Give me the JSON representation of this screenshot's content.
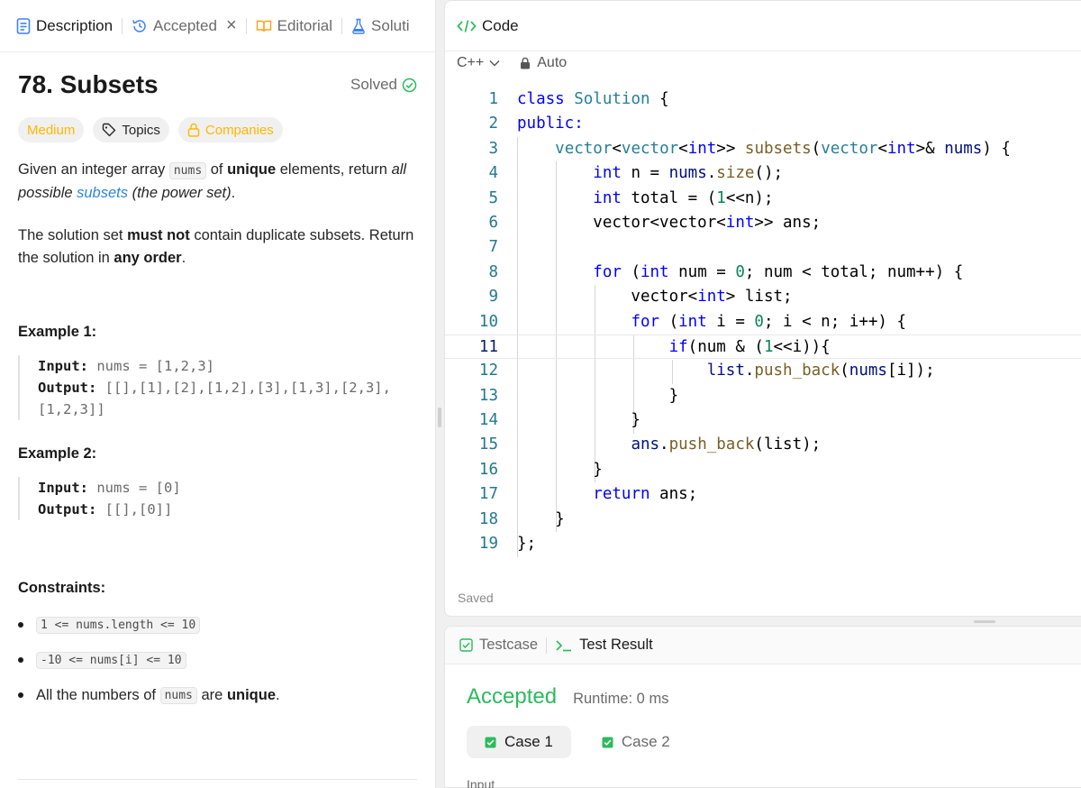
{
  "left_tabs": [
    {
      "label": "Description"
    },
    {
      "label": "Accepted"
    },
    {
      "label": "Editorial"
    },
    {
      "label": "Soluti"
    }
  ],
  "problem": {
    "title": "78. Subsets",
    "status": "Solved",
    "difficulty": "Medium",
    "topics_label": "Topics",
    "companies_label": "Companies"
  },
  "description": {
    "p1_a": "Given an integer array ",
    "p1_code": "nums",
    "p1_b": " of ",
    "p1_bold": "unique",
    "p1_c": " elements, return ",
    "p1_italic_a": "all possible ",
    "p1_link": "subsets",
    "p1_italic_b": " (the power set)",
    "p1_end": ".",
    "p2_a": "The solution set ",
    "p2_bold1": "must not",
    "p2_b": " contain duplicate subsets. Return the solution in ",
    "p2_bold2": "any order",
    "p2_end": "."
  },
  "examples": [
    {
      "title": "Example 1:",
      "input_label": "Input:",
      "input": " nums = [1,2,3]",
      "output_label": "Output:",
      "output_line1": " [[],[1],[2],[1,2],[3],[1,3],[2,3],",
      "output_line2": "[1,2,3]]"
    },
    {
      "title": "Example 2:",
      "input_label": "Input:",
      "input": " nums = [0]",
      "output_label": "Output:",
      "output_line1": " [[],[0]]",
      "output_line2": ""
    }
  ],
  "constraints": {
    "title": "Constraints:",
    "c1": "1 <= nums.length <= 10",
    "c2": "-10 <= nums[i] <= 10",
    "c3_a": "All the numbers of ",
    "c3_code": "nums",
    "c3_b": " are ",
    "c3_bold": "unique",
    "c3_end": "."
  },
  "code_panel": {
    "title": "Code",
    "language": "C++",
    "mode": "Auto",
    "saved": "Saved"
  },
  "code_lines": [
    {
      "n": "1"
    },
    {
      "n": "2"
    },
    {
      "n": "3"
    },
    {
      "n": "4"
    },
    {
      "n": "5"
    },
    {
      "n": "6"
    },
    {
      "n": "7"
    },
    {
      "n": "8"
    },
    {
      "n": "9"
    },
    {
      "n": "10"
    },
    {
      "n": "11"
    },
    {
      "n": "12"
    },
    {
      "n": "13"
    },
    {
      "n": "14"
    },
    {
      "n": "15"
    },
    {
      "n": "16"
    },
    {
      "n": "17"
    },
    {
      "n": "18"
    },
    {
      "n": "19"
    }
  ],
  "code_text": {
    "l1": [
      "class",
      " ",
      "Solution",
      " {"
    ],
    "l2": [
      "public",
      ":"
    ],
    "l3": [
      "    ",
      "vector",
      "<",
      "vector",
      "<",
      "int",
      ">> ",
      "subsets",
      "(",
      "vector",
      "<",
      "int",
      ">& ",
      "nums",
      ") {"
    ],
    "l4": [
      "        ",
      "int",
      " n = ",
      "nums",
      ".",
      "size",
      "();"
    ],
    "l5": [
      "        ",
      "int",
      " total = (",
      "1",
      "<<n);"
    ],
    "l6": [
      "        vector<vector<",
      "int",
      ">> ans;"
    ],
    "l7": [
      ""
    ],
    "l8": [
      "        ",
      "for",
      " (",
      "int",
      " num = ",
      "0",
      "; num < total; num++) {"
    ],
    "l9": [
      "            vector<",
      "int",
      "> list;"
    ],
    "l10": [
      "            ",
      "for",
      " (",
      "int",
      " i = ",
      "0",
      "; i < n; i++) {"
    ],
    "l11": [
      "                ",
      "if",
      "(num & (",
      "1",
      "<<i)){"
    ],
    "l12": [
      "                    ",
      "list",
      ".",
      "push_back",
      "(",
      "nums",
      "[i]);"
    ],
    "l13": [
      "                }"
    ],
    "l14": [
      "            }"
    ],
    "l15": [
      "            ",
      "ans",
      ".",
      "push_back",
      "(list);"
    ],
    "l16": [
      "        }"
    ],
    "l17": [
      "        ",
      "return",
      " ans;"
    ],
    "l18": [
      "    }"
    ],
    "l19": [
      "};"
    ]
  },
  "test_panel": {
    "testcase_tab": "Testcase",
    "result_tab": "Test Result",
    "verdict": "Accepted",
    "runtime": "Runtime: 0 ms",
    "cases": [
      {
        "label": "Case 1"
      },
      {
        "label": "Case 2"
      }
    ],
    "input_label": "Input"
  },
  "colors": {
    "accepted": "#2cbb5d",
    "medium": "#ffb800",
    "link": "#2e86de",
    "keyword": "#0000ff",
    "type": "#267f99",
    "function": "#795e26",
    "number": "#098658",
    "variable": "#001080"
  }
}
